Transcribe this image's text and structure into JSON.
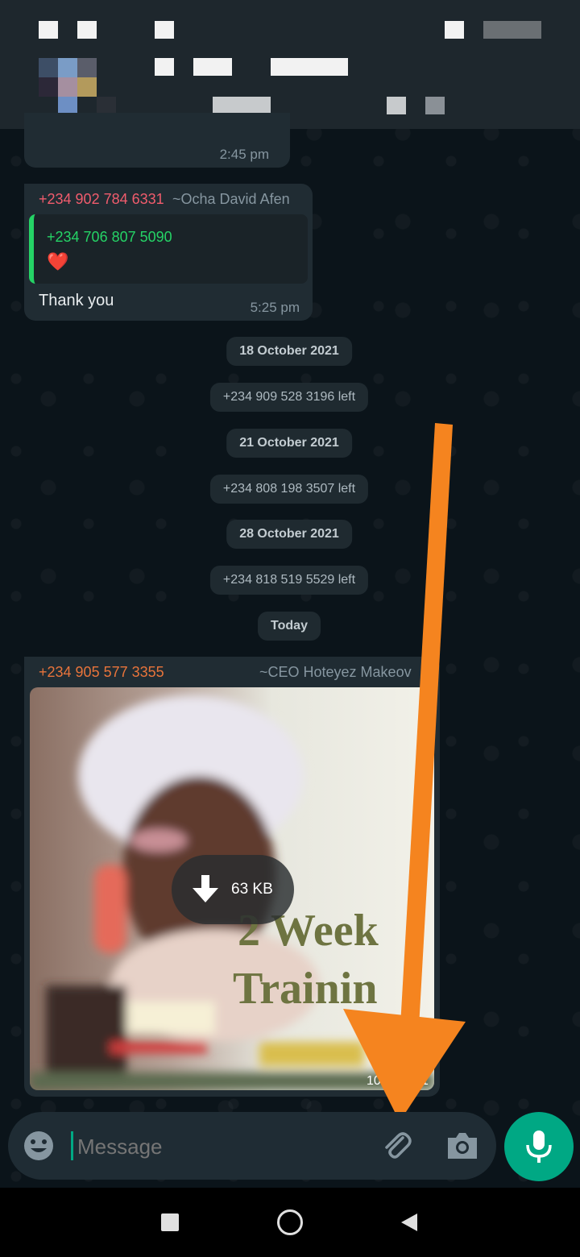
{
  "messages": {
    "first_time": "2:45 pm",
    "reply": {
      "sender_phone": "+234 902 784 6331",
      "sender_name": "~Ocha David Afen",
      "quoted_phone": "+234 706 807 5090",
      "quoted_text": "❤️",
      "text": "Thank you",
      "time": "5:25 pm"
    },
    "events": [
      {
        "type": "date",
        "text": "18 October 2021"
      },
      {
        "type": "system",
        "text": "+234 909 528 3196 left"
      },
      {
        "type": "date",
        "text": "21 October 2021"
      },
      {
        "type": "system",
        "text": "+234 808 198 3507 left"
      },
      {
        "type": "date",
        "text": "28 October 2021"
      },
      {
        "type": "system",
        "text": "+234 818 519 5529 left"
      },
      {
        "type": "date",
        "text": "Today"
      }
    ],
    "image_message": {
      "sender_phone": "+234 905 577 3355",
      "sender_name": "~CEO Hoteyez Makeov",
      "download_size": "63 KB",
      "time_fragment": "10",
      "time_fragment_end": "1",
      "flyer_text_line1": "2 Week",
      "flyer_text_line2": "Trainin"
    }
  },
  "composer": {
    "placeholder": "Message",
    "icons": [
      "emoji-icon",
      "attach-icon",
      "camera-icon",
      "mic-icon"
    ]
  },
  "colors": {
    "background": "#0b141a",
    "bubble": "#202c33",
    "accent_green": "#00a884",
    "sender_red": "#f15c6d",
    "sender_orange": "#e8743b",
    "quoted_green": "#25d366",
    "arrow_orange": "#f5841f"
  }
}
